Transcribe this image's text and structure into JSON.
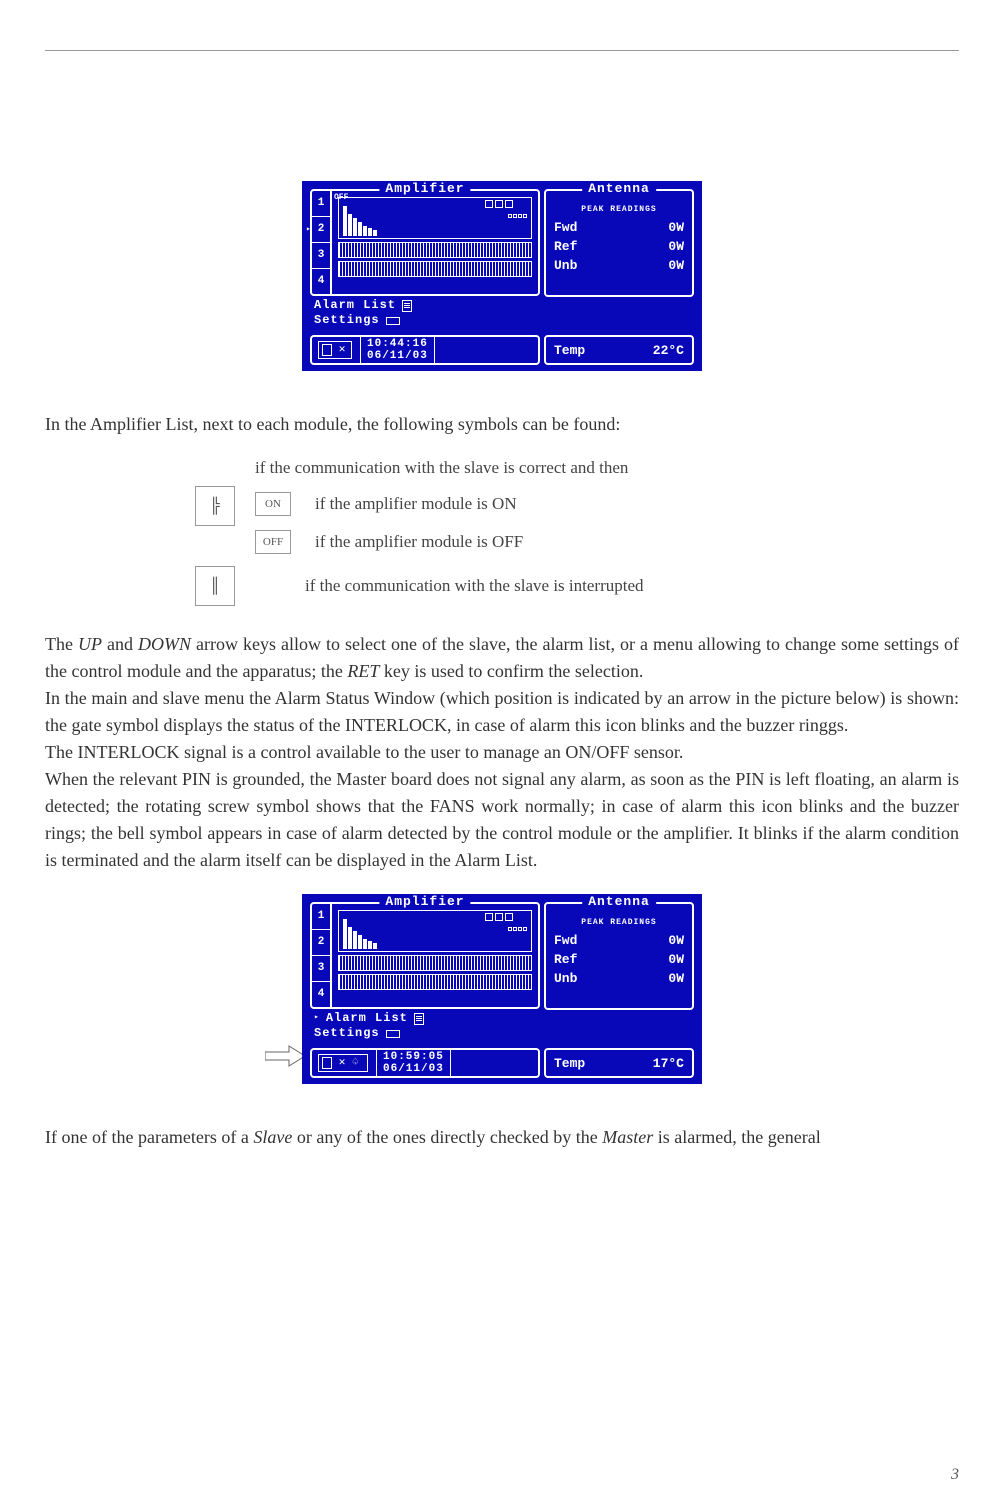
{
  "lcd1": {
    "amp_title": "Amplifier",
    "ant_title": "Antenna",
    "ant_sub": "PEAK  READINGS",
    "nums": [
      "1",
      "2",
      "3",
      "4"
    ],
    "off_tag": "OFF",
    "menu_alarm": "Alarm List",
    "menu_settings": "Settings",
    "ant_rows": [
      {
        "label": "Fwd",
        "val": "0W"
      },
      {
        "label": "Ref",
        "val": "0W"
      },
      {
        "label": "Unb",
        "val": "0W"
      }
    ],
    "time": "10:44:16",
    "date": "06/11/03",
    "temp_label": "Temp",
    "temp_val": "22°C"
  },
  "lcd2": {
    "amp_title": "Amplifier",
    "ant_title": "Antenna",
    "ant_sub": "PEAK  READINGS",
    "nums": [
      "1",
      "2",
      "3",
      "4"
    ],
    "menu_alarm": "Alarm List",
    "menu_settings": "Settings",
    "ant_rows": [
      {
        "label": "Fwd",
        "val": "0W"
      },
      {
        "label": "Ref",
        "val": "0W"
      },
      {
        "label": "Unb",
        "val": "0W"
      }
    ],
    "time": "10:59:05",
    "date": "06/11/03",
    "temp_label": "Temp",
    "temp_val": "17°C"
  },
  "text": {
    "p1": "In the Amplifier List, next to each module, the following symbols can be found:",
    "sym_correct": "if the communication with the slave is correct and then",
    "sym_on_label": "ON",
    "sym_on_text": "if the amplifier module is ON",
    "sym_off_label": "OFF",
    "sym_off_text": "if the amplifier module is OFF",
    "sym_interrupted": "if the communication with the slave is interrupted",
    "p2a": "The ",
    "p2_up": "UP",
    "p2b": " and ",
    "p2_down": "DOWN",
    "p2c": " arrow keys allow to select one of the slave, the alarm list, or a menu allowing to change some settings of the control module and the apparatus; the ",
    "p2_ret": "RET",
    "p2d": " key is used to confirm the selection.",
    "p3": "In the main and slave menu the Alarm Status Window (which position is indicated by an arrow in the picture below) is shown: the gate symbol displays the status of the INTERLOCK, in case of alarm this icon blinks and the buzzer ringgs.",
    "p4": "The INTERLOCK signal is a control available to the user to manage an ON/OFF sensor.",
    "p5": "When the relevant PIN is grounded, the Master board does not signal any alarm, as soon as the PIN is left floating, an alarm is detected; the rotating screw symbol shows that the FANS work normally; in case of alarm this icon blinks and the buzzer rings; the bell symbol appears in case of alarm detected by the control module or the amplifier. It blinks if the alarm condition is terminated and the alarm itself can be displayed in the Alarm List.",
    "p6a": "If one of the parameters of a ",
    "p6_slave": "Slave",
    "p6b": " or any of the ones directly checked by the ",
    "p6_master": "Master",
    "p6c": " is alarmed, the general",
    "page_num": "3"
  },
  "icons": {
    "comm_ok": "╠",
    "comm_bad": "║"
  }
}
